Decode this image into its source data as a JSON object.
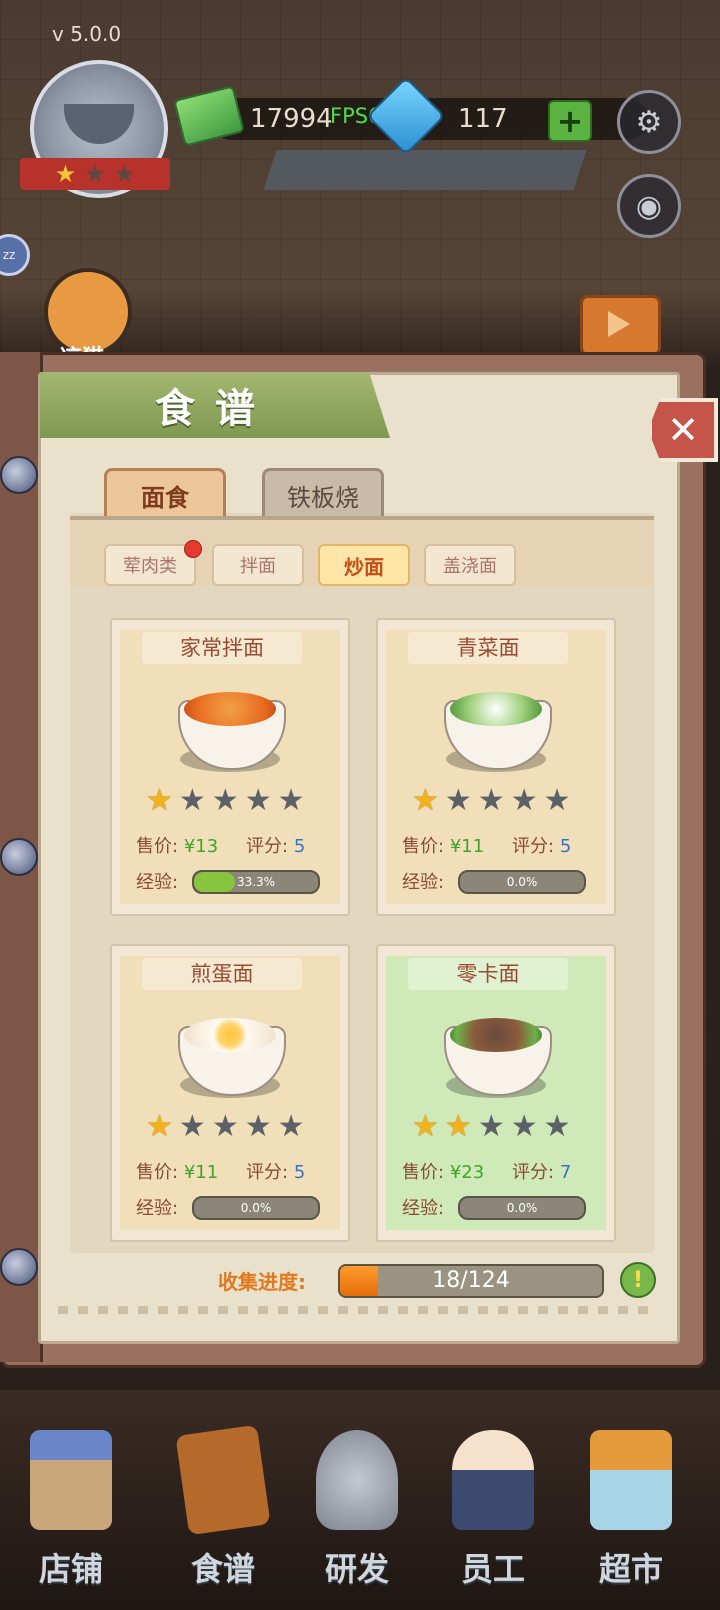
{
  "hud": {
    "version": "v 5.0.0",
    "money": "17994",
    "fps": "FPS60",
    "gems": "117",
    "plus": "+",
    "cat_label": "凉猫",
    "zz": "zz"
  },
  "book": {
    "title": "食谱",
    "close": "✕",
    "tabs": [
      {
        "label": "面食",
        "active": true
      },
      {
        "label": "铁板烧",
        "active": false
      }
    ],
    "subtabs": [
      {
        "label": "荤肉类",
        "active": false,
        "dot": true
      },
      {
        "label": "拌面",
        "active": false
      },
      {
        "label": "炒面",
        "active": true
      },
      {
        "label": "盖浇面",
        "active": false
      }
    ],
    "price_label": "售价:",
    "score_label": "评分:",
    "exp_label": "经验:",
    "recipes": [
      {
        "name": "家常拌面",
        "price": "¥13",
        "score": "5",
        "stars": 1,
        "exp": "33.3%",
        "exp_value": 0.333,
        "food": "food-orange",
        "highlight": false
      },
      {
        "name": "青菜面",
        "price": "¥11",
        "score": "5",
        "stars": 1,
        "exp": "0.0%",
        "exp_value": 0.0,
        "food": "food-greens",
        "highlight": false
      },
      {
        "name": "煎蛋面",
        "price": "¥11",
        "score": "5",
        "stars": 1,
        "exp": "0.0%",
        "exp_value": 0.0,
        "food": "food-egg",
        "highlight": false
      },
      {
        "name": "零卡面",
        "price": "¥23",
        "score": "7",
        "stars": 2,
        "exp": "0.0%",
        "exp_value": 0.0,
        "food": "food-meat",
        "highlight": true
      }
    ],
    "progress_label": "收集进度:",
    "progress_text": "18/124",
    "progress_value": 0.145,
    "info": "!"
  },
  "nav": [
    {
      "label": "店铺",
      "cls": "nav-shop"
    },
    {
      "label": "食谱",
      "cls": "nav-recipe"
    },
    {
      "label": "研发",
      "cls": "nav-research"
    },
    {
      "label": "员工",
      "cls": "nav-staff"
    },
    {
      "label": "超市",
      "cls": "nav-market"
    }
  ],
  "colors": {
    "banner": "#8fa65e",
    "close": "#c65549",
    "price": "#3fa52a",
    "score": "#3a70c8",
    "exp_fill": "#88c53e",
    "progress_fill": "#f08a1c"
  },
  "icons": [
    "settings-icon",
    "camera-icon",
    "money-icon",
    "gem-icon",
    "star-icon",
    "info-icon"
  ]
}
